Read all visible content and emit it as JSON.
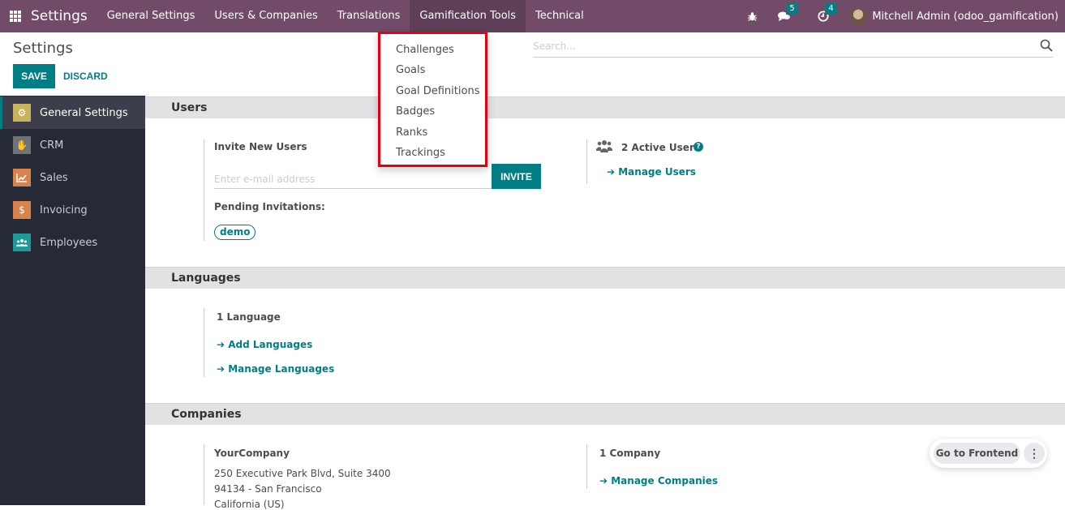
{
  "navbar": {
    "app_title": "Settings",
    "menu": [
      "General Settings",
      "Users & Companies",
      "Translations",
      "Gamification Tools",
      "Technical"
    ],
    "messages_count": "5",
    "activities_count": "4",
    "user": "Mitchell Admin (odoo_gamification)"
  },
  "dropdown": {
    "items": [
      "Challenges",
      "Goals",
      "Goal Definitions",
      "Badges",
      "Ranks",
      "Trackings"
    ]
  },
  "control_panel": {
    "title": "Settings",
    "save_label": "SAVE",
    "discard_label": "DISCARD",
    "search_placeholder": "Search..."
  },
  "sidebar": {
    "items": [
      {
        "label": "General Settings",
        "icon": "gear-icon",
        "color": "#c8b45f"
      },
      {
        "label": "CRM",
        "icon": "handshake-icon",
        "color": "#6e7378"
      },
      {
        "label": "Sales",
        "icon": "chart-line-icon",
        "color": "#d8834b"
      },
      {
        "label": "Invoicing",
        "icon": "invoice-icon",
        "color": "#d8834b"
      },
      {
        "label": "Employees",
        "icon": "users-icon",
        "color": "#1e9a9a"
      }
    ]
  },
  "sections": {
    "users": {
      "title": "Users",
      "invite_label": "Invite New Users",
      "email_placeholder": "Enter e-mail address",
      "invite_button": "INVITE",
      "pending_label": "Pending Invitations:",
      "pending": [
        "demo"
      ],
      "active_users": "2 Active Users",
      "manage_users": "Manage Users"
    },
    "languages": {
      "title": "Languages",
      "count": "1 Language",
      "add": "Add Languages",
      "manage": "Manage Languages"
    },
    "companies": {
      "title": "Companies",
      "company_name": "YourCompany",
      "address_line1": "250 Executive Park Blvd, Suite 3400",
      "address_line2": "94134 - San Francisco",
      "address_line3": "California (US)",
      "count": "1 Company",
      "manage": "Manage Companies"
    }
  },
  "floating": {
    "frontend_label": "Go to Frontend"
  },
  "colors": {
    "brand": "#714b67",
    "accent": "#017e84",
    "highlight": "#e4000f"
  }
}
